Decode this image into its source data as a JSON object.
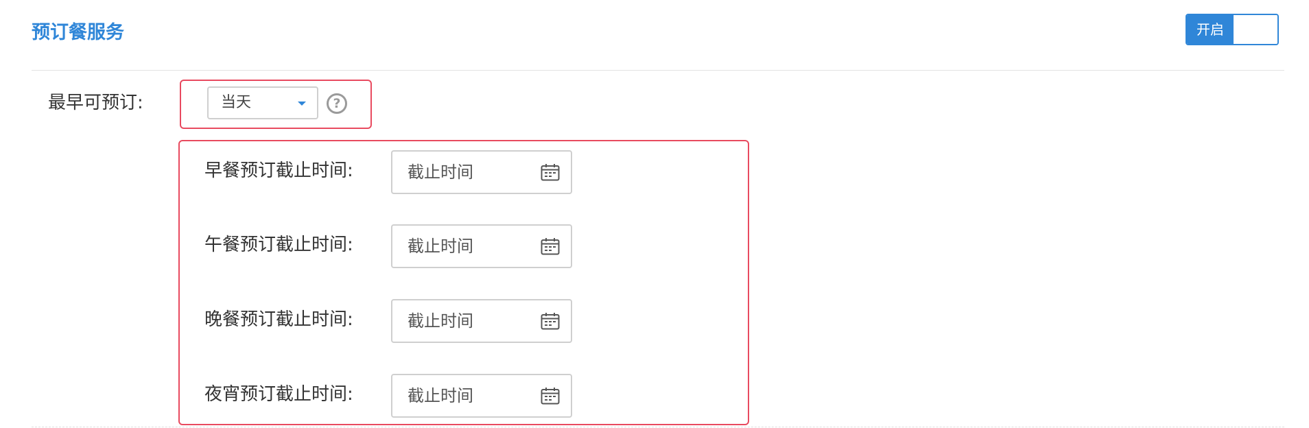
{
  "section": {
    "title": "预订餐服务"
  },
  "toggle": {
    "on_label": "开启",
    "state": "on",
    "accent_color": "#2f86d8"
  },
  "earliest_booking": {
    "label": "最早可预订:",
    "selected": "当天",
    "help_icon": "question-circle-icon",
    "help_glyph": "?"
  },
  "cutoff_times": [
    {
      "label": "早餐预订截止时间:",
      "placeholder": "截止时间",
      "icon": "calendar-icon"
    },
    {
      "label": "午餐预订截止时间:",
      "placeholder": "截止时间",
      "icon": "calendar-icon"
    },
    {
      "label": "晚餐预订截止时间:",
      "placeholder": "截止时间",
      "icon": "calendar-icon"
    },
    {
      "label": "夜宵预订截止时间:",
      "placeholder": "截止时间",
      "icon": "calendar-icon"
    }
  ],
  "colors": {
    "title_blue": "#2f86d8",
    "highlight_red": "#e84a5f",
    "input_border": "#cfcfcf"
  }
}
